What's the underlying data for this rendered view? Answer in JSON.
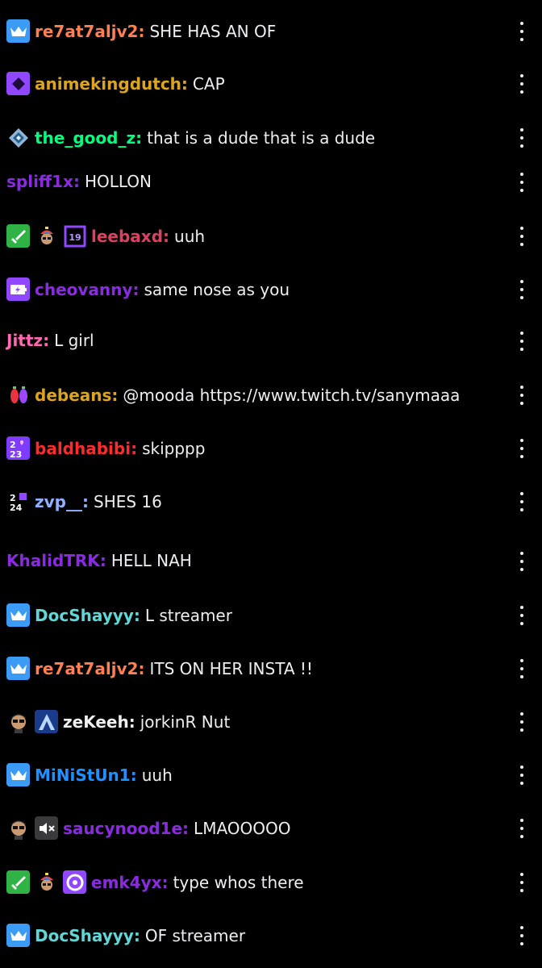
{
  "messages": [
    {
      "username": "re7at7aljv2",
      "color": "#ff7f50",
      "text": "SHE HAS AN OF",
      "badges": [
        "crown"
      ]
    },
    {
      "username": "animekingdutch",
      "color": "#daa520",
      "text": "CAP",
      "badges": [
        "gem"
      ]
    },
    {
      "username": "the_good_z",
      "color": "#00ff7f",
      "text": "that is a dude that is a dude",
      "badges": [
        "diamond-gem"
      ]
    },
    {
      "username": "spliff1x",
      "color": "#8a2be2",
      "text": "HOLLON",
      "badges": []
    },
    {
      "username": "leebaxd",
      "color": "#e0405f",
      "text": "uuh",
      "badges": [
        "sword",
        "propeller-hat",
        "sub-19"
      ]
    },
    {
      "username": "cheovanny",
      "color": "#8a2be2",
      "text": "same nose as you",
      "badges": [
        "battery"
      ]
    },
    {
      "username": "Jittz",
      "color": "#ff69b4",
      "text": "L girl",
      "badges": []
    },
    {
      "username": "debeans",
      "color": "#daa520",
      "text": "@mooda https://www.twitch.tv/sanymaaa",
      "badges": [
        "lights"
      ]
    },
    {
      "username": "baldhabibi",
      "color": "#ff2a2a",
      "text": "skipppp",
      "badges": [
        "year-2023"
      ]
    },
    {
      "username": "zvp__",
      "color": "#8fb2ff",
      "text": "SHES 16",
      "badges": [
        "year-2024"
      ]
    },
    {
      "username": "KhalidTRK",
      "color": "#8a2be2",
      "text": "HELL NAH",
      "badges": []
    },
    {
      "username": "DocShayyy",
      "color": "#5fd7d7",
      "text": "L streamer",
      "badges": [
        "crown"
      ]
    },
    {
      "username": "re7at7aljv2",
      "color": "#ff7f50",
      "text": "ITS ON HER INSTA !!",
      "badges": [
        "crown"
      ]
    },
    {
      "username": "zeKeeh",
      "color": "#efeff1",
      "text": "jorkinR Nut",
      "badges": [
        "face",
        "arch-a"
      ]
    },
    {
      "username": "MiNiStUn1",
      "color": "#1e90ff",
      "text": "uuh",
      "badges": [
        "crown"
      ]
    },
    {
      "username": "saucynood1e",
      "color": "#8a2be2",
      "text": "LMAOOOOO",
      "badges": [
        "face",
        "muted"
      ]
    },
    {
      "username": "emk4yx",
      "color": "#8a2be2",
      "text": "type whos there",
      "badges": [
        "sword",
        "propeller-hat",
        "disc"
      ]
    },
    {
      "username": "DocShayyy",
      "color": "#5fd7d7",
      "text": "OF streamer",
      "badges": [
        "crown"
      ]
    }
  ],
  "colors": {
    "background": "#000000",
    "text": "#efeff1"
  }
}
